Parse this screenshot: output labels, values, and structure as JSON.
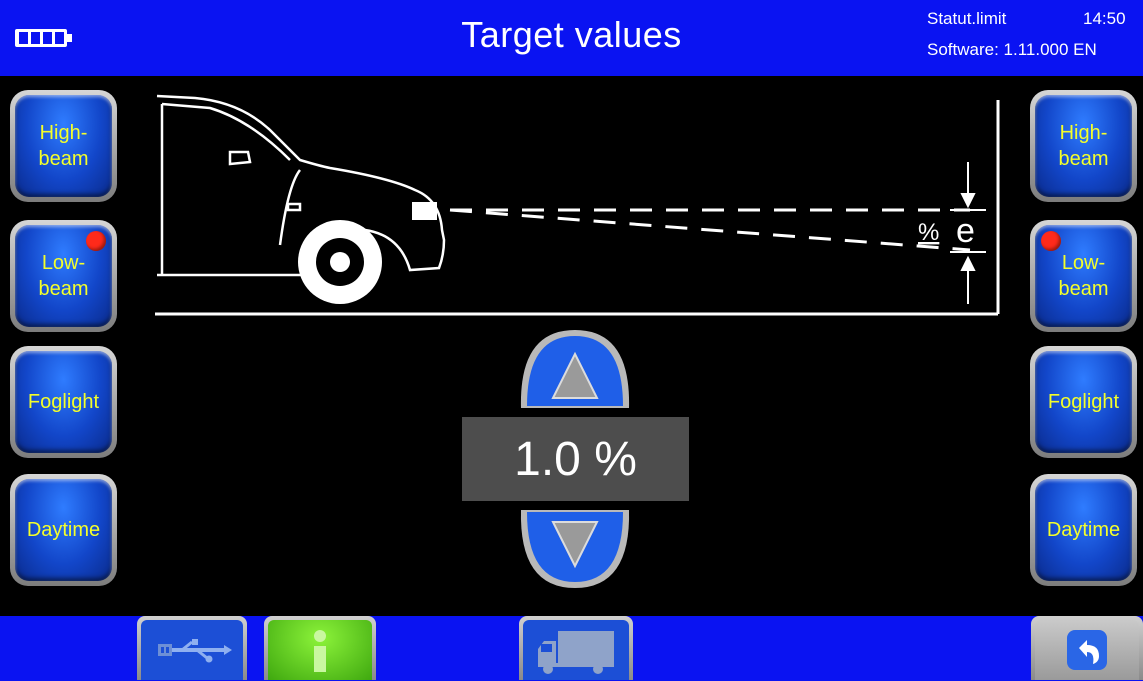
{
  "header": {
    "title": "Target values",
    "status_label": "Statut.limit",
    "time": "14:50",
    "software": "Software: 1.11.000 EN",
    "battery_icon": "battery-full-icon"
  },
  "left_buttons": [
    {
      "label_line1": "High-",
      "label_line2": "beam",
      "active": false
    },
    {
      "label_line1": "Low-",
      "label_line2": "beam",
      "active": true
    },
    {
      "label_line1": "Foglight",
      "label_line2": "",
      "active": false
    },
    {
      "label_line1": "Daytime",
      "label_line2": "",
      "active": false
    }
  ],
  "right_buttons": [
    {
      "label_line1": "High-",
      "label_line2": "beam",
      "active": false
    },
    {
      "label_line1": "Low-",
      "label_line2": "beam",
      "active": true
    },
    {
      "label_line1": "Foglight",
      "label_line2": "",
      "active": false
    },
    {
      "label_line1": "Daytime",
      "label_line2": "",
      "active": false
    }
  ],
  "diagram": {
    "percent_label": "%",
    "e_label": "e"
  },
  "stepper": {
    "value": "1.0 %",
    "up_icon": "arrow-up-icon",
    "down_icon": "arrow-down-icon"
  },
  "footer": {
    "buttons": [
      "usb-icon",
      "info-icon",
      "truck-icon",
      "back-icon"
    ]
  },
  "colors": {
    "bar_blue": "#0a13f2",
    "label_yellow": "#f4ff2a",
    "active_dot": "#ff2a1a",
    "info_green": "#5fd61c"
  }
}
